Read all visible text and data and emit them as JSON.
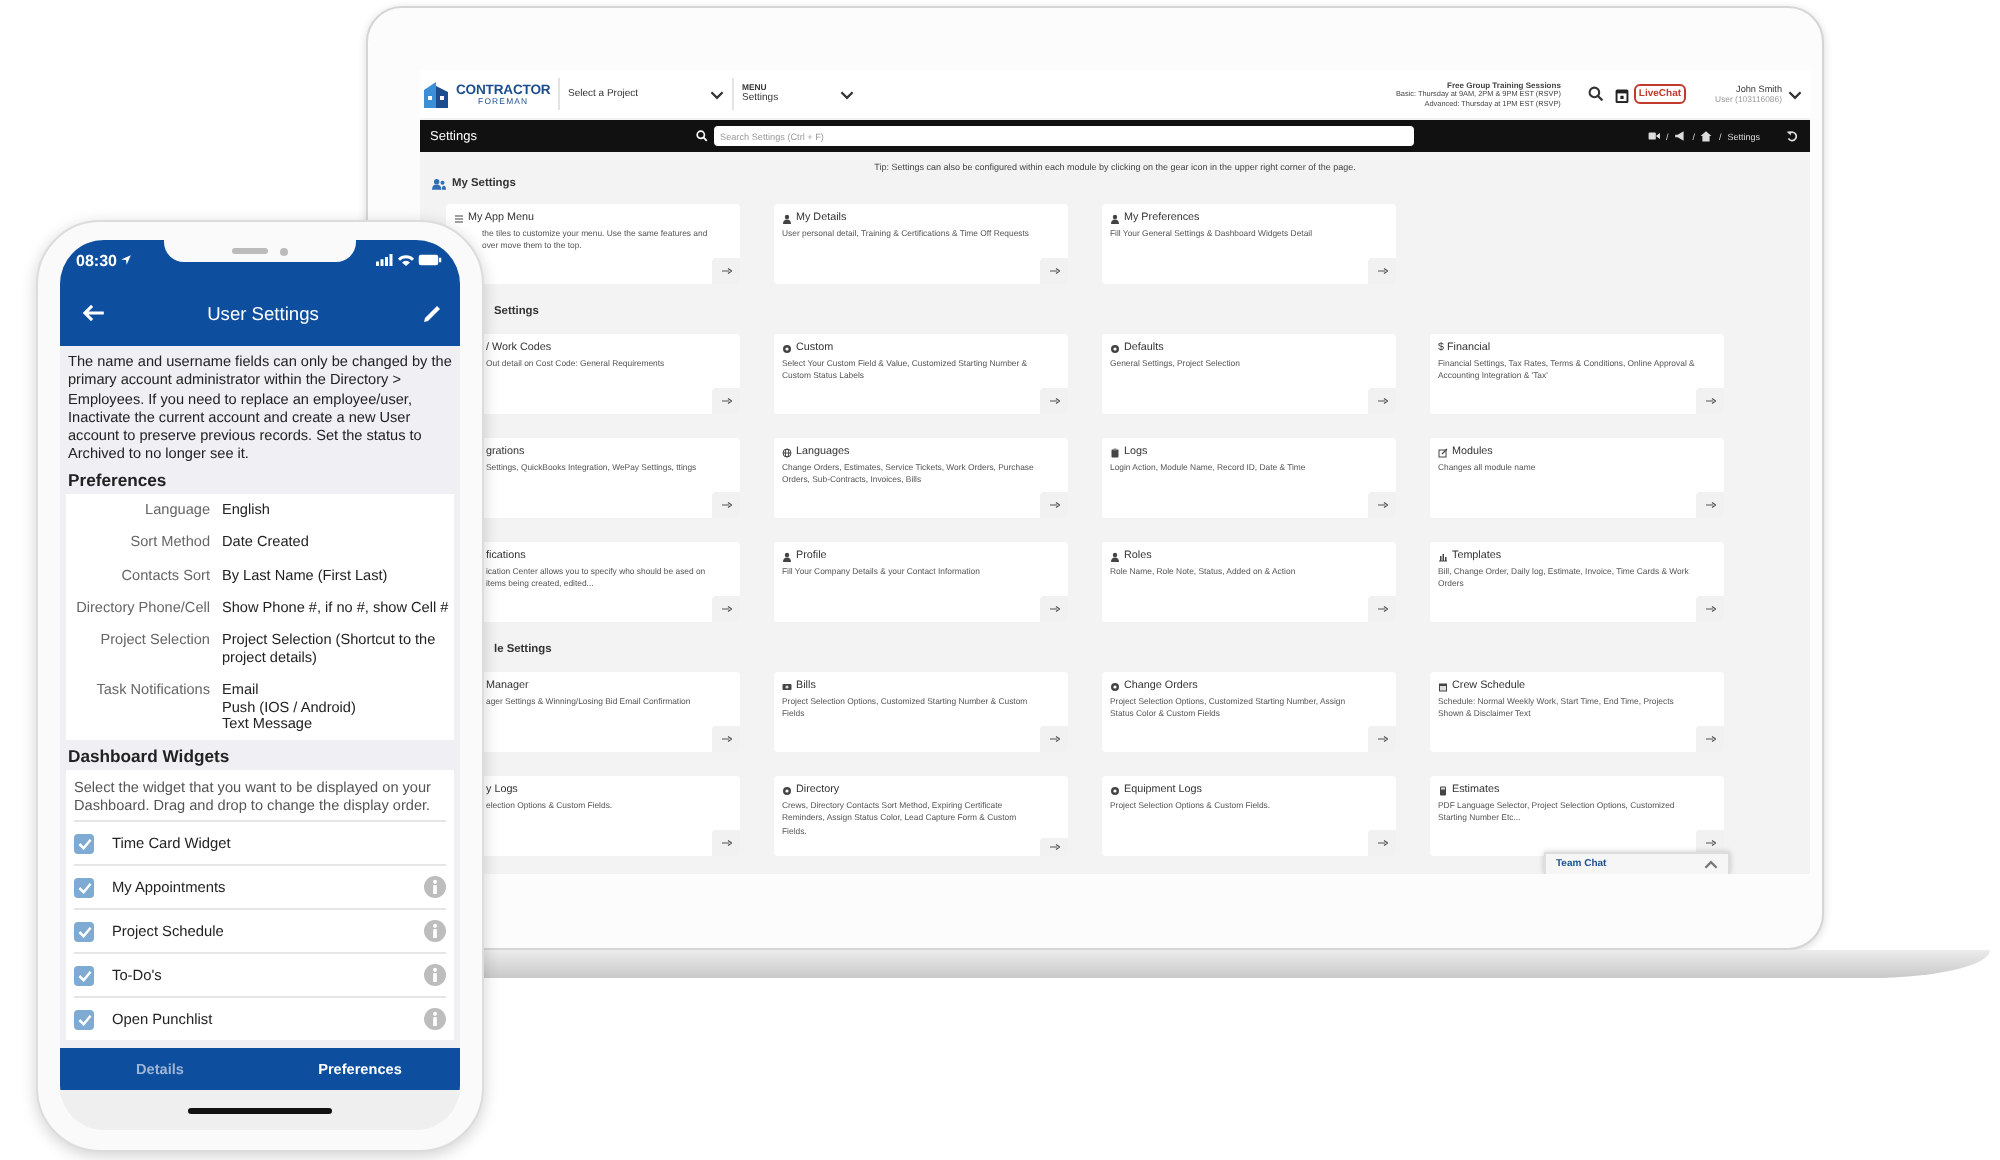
{
  "laptop": {
    "header": {
      "logo_top": "CONTRACTOR",
      "logo_bottom": "FOREMAN",
      "project_select": "Select a Project",
      "menu_label": "MENU",
      "menu_value": "Settings",
      "training_title": "Free Group Training Sessions",
      "training_lines": [
        "Basic: Thursday at 9AM, 2PM & 9PM EST (RSVP)",
        "Advanced: Thursday at 1PM EST (RSVP)"
      ],
      "livechat": "LiveChat",
      "user_name": "John Smith",
      "user_id": "User (103116086)"
    },
    "toolbar": {
      "title": "Settings",
      "search_placeholder": "Search Settings (Ctrl + F)",
      "breadcrumb_separators": [
        "/",
        "/",
        "/"
      ],
      "breadcrumb_current": "Settings"
    },
    "tip": "Tip: Settings can also be configured within each module by clicking on the gear icon in the upper right corner of the page.",
    "sections": [
      {
        "title": "My Settings",
        "cards": [
          {
            "title": "My App Menu",
            "text": "the tiles to customize your menu. Use the same features and over move them to the top."
          },
          {
            "title": "My Details",
            "text": "User personal detail, Training & Certifications & Time Off Requests"
          },
          {
            "title": "My Preferences",
            "text": "Fill Your General Settings & Dashboard Widgets Detail"
          }
        ]
      },
      {
        "title": "Settings",
        "cards": [
          {
            "title": "/ Work Codes",
            "text": "Out detail on Cost Code: General Requirements"
          },
          {
            "title": "Custom",
            "text": "Select Your Custom Field & Value, Customized Starting Number & Custom Status Labels"
          },
          {
            "title": "Defaults",
            "text": "General Settings, Project Selection"
          },
          {
            "title": "$ Financial",
            "text": "Financial Settings, Tax Rates, Terms & Conditions, Online Approval & Accounting Integration & 'Tax'"
          },
          {
            "title": "grations",
            "text": "Settings, QuickBooks Integration, WePay Settings, ttings"
          },
          {
            "title": "Languages",
            "text": "Change Orders, Estimates, Service Tickets, Work Orders, Purchase Orders, Sub-Contracts, Invoices, Bills"
          },
          {
            "title": "Logs",
            "text": "Login Action, Module Name, Record ID, Date & Time"
          },
          {
            "title": "Modules",
            "text": "Changes all module name"
          },
          {
            "title": "fications",
            "text": "ication Center allows you to specify who should be ased on items being created, edited..."
          },
          {
            "title": "Profile",
            "text": "Fill Your Company Details & your Contact Information"
          },
          {
            "title": "Roles",
            "text": "Role Name, Role Note, Status, Added on & Action"
          },
          {
            "title": "Templates",
            "text": "Bill, Change Order, Daily log, Estimate, Invoice, Time Cards & Work Orders"
          }
        ]
      },
      {
        "title": "le Settings",
        "cards": [
          {
            "title": "Manager",
            "text": "ager Settings & Winning/Losing Bid Email Confirmation"
          },
          {
            "title": "Bills",
            "text": "Project Selection Options, Customized Starting Number & Custom Fields"
          },
          {
            "title": "Change Orders",
            "text": "Project Selection Options, Customized Starting Number, Assign Status Color & Custom Fields"
          },
          {
            "title": "Crew Schedule",
            "text": "Schedule: Normal Weekly Work, Start Time, End Time, Projects Shown & Disclaimer Text"
          },
          {
            "title": "y Logs",
            "text": "election Options & Custom Fields."
          },
          {
            "title": "Directory",
            "text": "Crews, Directory Contacts Sort Method, Expiring Certificate Reminders, Assign Status Color, Lead Capture Form & Custom Fields."
          },
          {
            "title": "Equipment Logs",
            "text": "Project Selection Options & Custom Fields."
          },
          {
            "title": "Estimates",
            "text": "PDF Language Selector, Project Selection Options, Customized Starting Number Etc..."
          }
        ]
      }
    ],
    "team_chat": "Team Chat"
  },
  "phone": {
    "time": "08:30",
    "title": "User Settings",
    "notice": "The name and username fields can only be changed by the primary account administrator within the Directory > Employees. If you need to replace an employee/user, Inactivate the current account and create a new User account to preserve previous records. Set the status to Archived to no longer see it.",
    "preferences_title": "Preferences",
    "preferences": [
      {
        "label": "Language",
        "values": [
          "English"
        ]
      },
      {
        "label": "Sort Method",
        "values": [
          "Date Created"
        ]
      },
      {
        "label": "Contacts Sort",
        "values": [
          "By Last Name (First Last)"
        ]
      },
      {
        "label": "Directory Phone/Cell",
        "values": [
          "Show Phone #, if no #, show Cell #"
        ]
      },
      {
        "label": "Project Selection",
        "values": [
          "Project Selection (Shortcut to the project details)"
        ]
      },
      {
        "label": "Task Notifications",
        "values": [
          "Email",
          "Push (IOS / Android)",
          "Text Message"
        ]
      }
    ],
    "widgets_title": "Dashboard Widgets",
    "widgets_text": "Select the widget that you want to be displayed on your Dashboard. Drag and drop to change the display order.",
    "widgets": [
      {
        "label": "Time Card Widget",
        "checked": true,
        "info": false
      },
      {
        "label": "My Appointments",
        "checked": true,
        "info": true
      },
      {
        "label": "Project Schedule",
        "checked": true,
        "info": true
      },
      {
        "label": "To-Do's",
        "checked": true,
        "info": true
      },
      {
        "label": "Open Punchlist",
        "checked": true,
        "info": true
      }
    ],
    "tabs": [
      {
        "label": "Details",
        "selected": false
      },
      {
        "label": "Preferences",
        "selected": true
      }
    ]
  }
}
